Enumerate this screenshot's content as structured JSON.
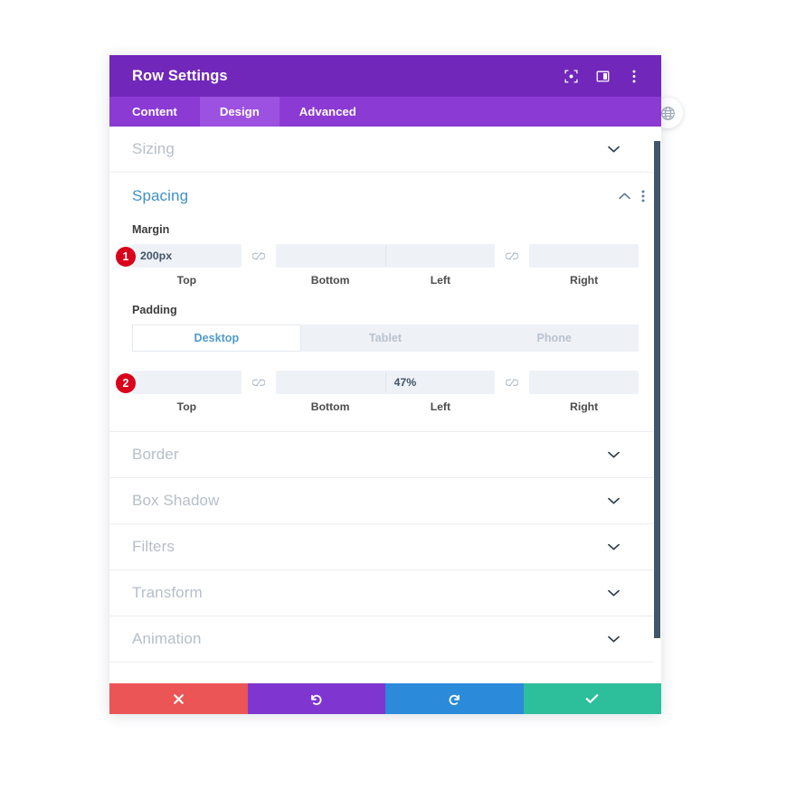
{
  "window": {
    "title": "Row Settings",
    "header_icons": [
      {
        "name": "focus-icon",
        "label": "Focus"
      },
      {
        "name": "layout-panel-icon",
        "label": "Layout"
      },
      {
        "name": "more-vertical-icon",
        "label": "More options"
      }
    ],
    "tabs": [
      {
        "label": "Content",
        "active": false
      },
      {
        "label": "Design",
        "active": true
      },
      {
        "label": "Advanced",
        "active": false
      }
    ]
  },
  "side_button": {
    "name": "globe-icon",
    "label": "Globe"
  },
  "sections": [
    {
      "label": "Sizing",
      "state": "collapsed"
    },
    {
      "label": "Spacing",
      "state": "expanded"
    },
    {
      "label": "Border",
      "state": "collapsed"
    },
    {
      "label": "Box Shadow",
      "state": "collapsed"
    },
    {
      "label": "Filters",
      "state": "collapsed"
    },
    {
      "label": "Transform",
      "state": "collapsed"
    },
    {
      "label": "Animation",
      "state": "collapsed"
    }
  ],
  "spacing": {
    "title": "Spacing",
    "margin": {
      "label": "Margin",
      "badge": "1",
      "fields": [
        {
          "caption": "Top",
          "value": "200px",
          "placeholder": ""
        },
        {
          "caption": "Bottom",
          "value": "",
          "placeholder": ""
        },
        {
          "caption": "Left",
          "value": "",
          "placeholder": ""
        },
        {
          "caption": "Right",
          "value": "",
          "placeholder": ""
        }
      ],
      "link_icon": "broken-link-icon"
    },
    "padding": {
      "label": "Padding",
      "badge": "2",
      "device_tabs": [
        {
          "label": "Desktop",
          "active": true
        },
        {
          "label": "Tablet",
          "active": false
        },
        {
          "label": "Phone",
          "active": false
        }
      ],
      "fields": [
        {
          "caption": "Top",
          "value": "",
          "placeholder": ""
        },
        {
          "caption": "Bottom",
          "value": "",
          "placeholder": ""
        },
        {
          "caption": "Left",
          "value": "47%",
          "placeholder": ""
        },
        {
          "caption": "Right",
          "value": "",
          "placeholder": ""
        }
      ],
      "link_icon": "broken-link-icon"
    }
  },
  "footer": {
    "buttons": [
      {
        "name": "cancel-button",
        "icon": "close-icon",
        "color": "#eb5555"
      },
      {
        "name": "undo-button",
        "icon": "undo-icon",
        "color": "#7f36d1"
      },
      {
        "name": "redo-button",
        "icon": "redo-icon",
        "color": "#2b8ad9"
      },
      {
        "name": "save-button",
        "icon": "check-icon",
        "color": "#2dbf9c"
      }
    ]
  },
  "colors": {
    "header_purple": "#7127ba",
    "tabbar_purple": "#8b3ad3",
    "tab_active_purple": "#9c51e0",
    "section_title_blue": "#3f90c4",
    "badge_red": "#d9001b",
    "input_bg": "#eef1f6",
    "scrollbar": "#41556b"
  }
}
